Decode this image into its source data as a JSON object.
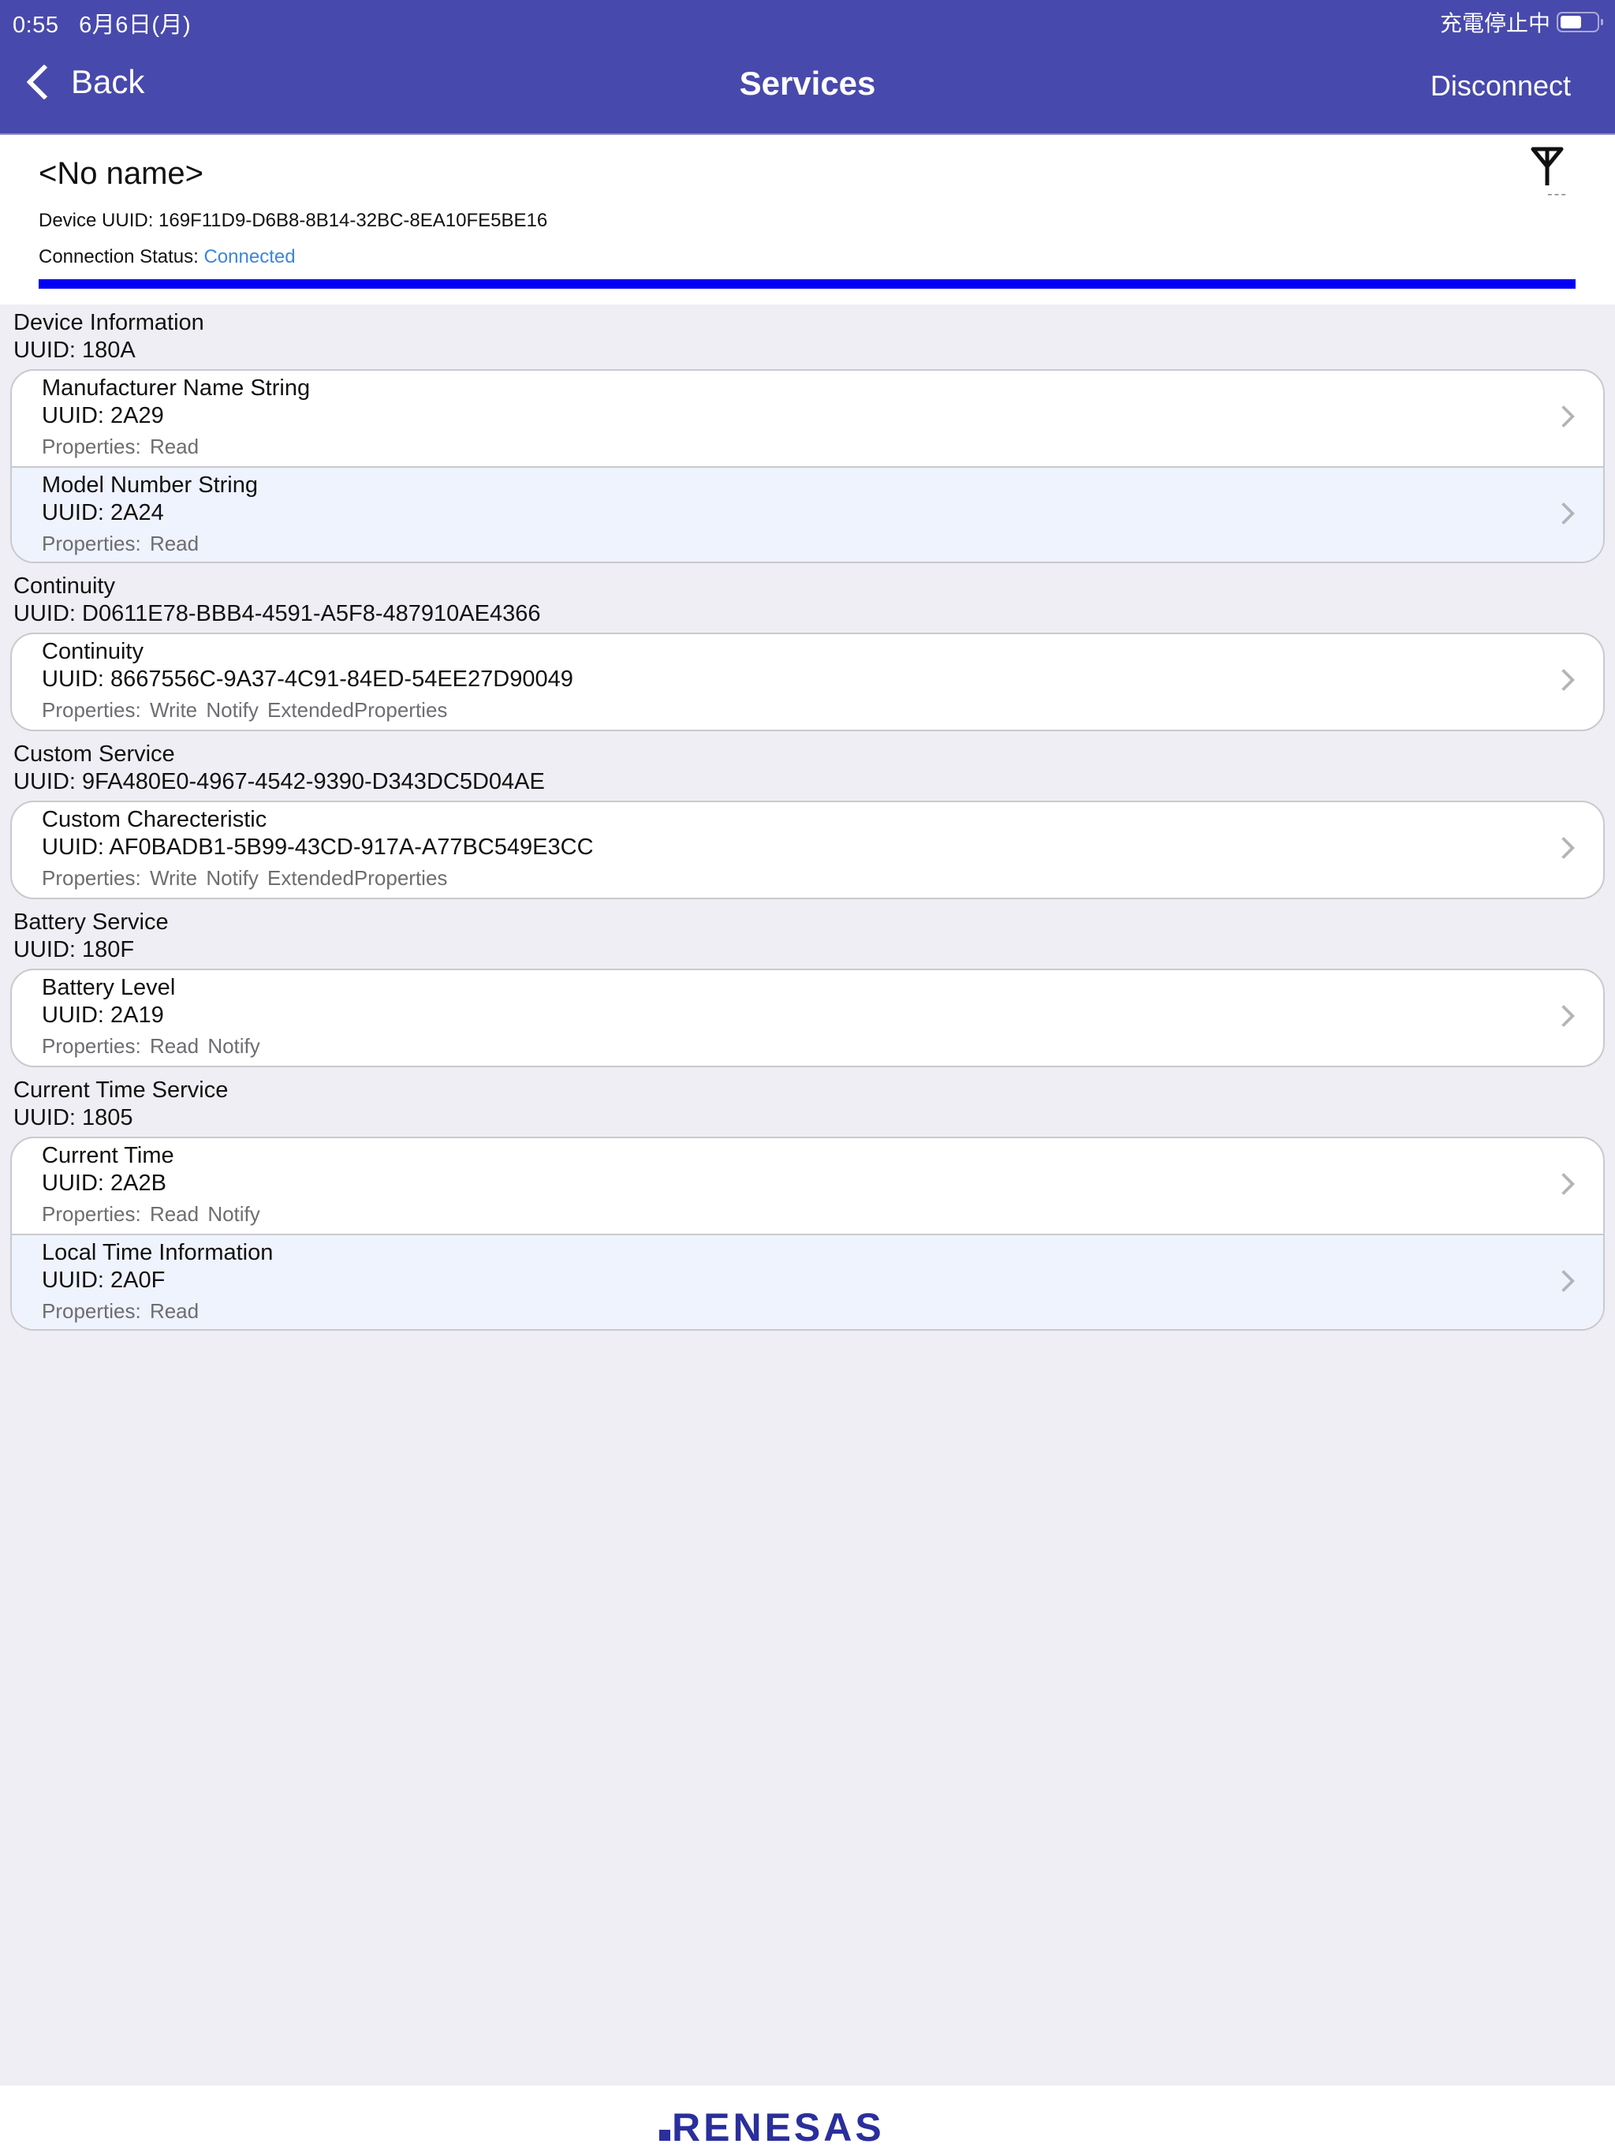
{
  "status_bar": {
    "time": "0:55",
    "date": "6月6日(月)",
    "charging_text": "充電停止中",
    "battery_icon": "battery-icon"
  },
  "nav": {
    "back_label": "Back",
    "title": "Services",
    "disconnect_label": "Disconnect",
    "accent_color": "#4849AC"
  },
  "device": {
    "name": "<No name>",
    "uuid_label": "Device UUID:",
    "uuid": "169F11D9-D6B8-8B14-32BC-8EA10FE5BE16",
    "status_label": "Connection Status:",
    "status_value": "Connected",
    "status_color": "#3A85E0",
    "rssi": "---",
    "signal_icon": "antenna-icon",
    "progress_percent": 100,
    "progress_color": "#0000F5"
  },
  "services": [
    {
      "name": "Device Information",
      "uuid": "UUID: 180A",
      "characteristics": [
        {
          "name": "Manufacturer Name String",
          "uuid": "UUID: 2A29",
          "properties": "Properties:  Read"
        },
        {
          "name": "Model Number String",
          "uuid": "UUID: 2A24",
          "properties": "Properties:  Read"
        }
      ]
    },
    {
      "name": "Continuity",
      "uuid": "UUID: D0611E78-BBB4-4591-A5F8-487910AE4366",
      "characteristics": [
        {
          "name": "Continuity",
          "uuid": "UUID: 8667556C-9A37-4C91-84ED-54EE27D90049",
          "properties": "Properties:  Write  Notify  ExtendedProperties"
        }
      ]
    },
    {
      "name": "Custom Service",
      "uuid": "UUID: 9FA480E0-4967-4542-9390-D343DC5D04AE",
      "characteristics": [
        {
          "name": "Custom Charecteristic",
          "uuid": "UUID: AF0BADB1-5B99-43CD-917A-A77BC549E3CC",
          "properties": "Properties:  Write  Notify  ExtendedProperties"
        }
      ]
    },
    {
      "name": "Battery Service",
      "uuid": "UUID: 180F",
      "characteristics": [
        {
          "name": "Battery Level",
          "uuid": "UUID: 2A19",
          "properties": "Properties:  Read  Notify"
        }
      ]
    },
    {
      "name": "Current Time Service",
      "uuid": "UUID: 1805",
      "characteristics": [
        {
          "name": "Current Time",
          "uuid": "UUID: 2A2B",
          "properties": "Properties:  Read  Notify"
        },
        {
          "name": "Local Time Information",
          "uuid": "UUID: 2A0F",
          "properties": "Properties:  Read"
        }
      ]
    }
  ],
  "footer": {
    "logo_text": "RENESAS",
    "logo_color": "#2A2F9C"
  }
}
